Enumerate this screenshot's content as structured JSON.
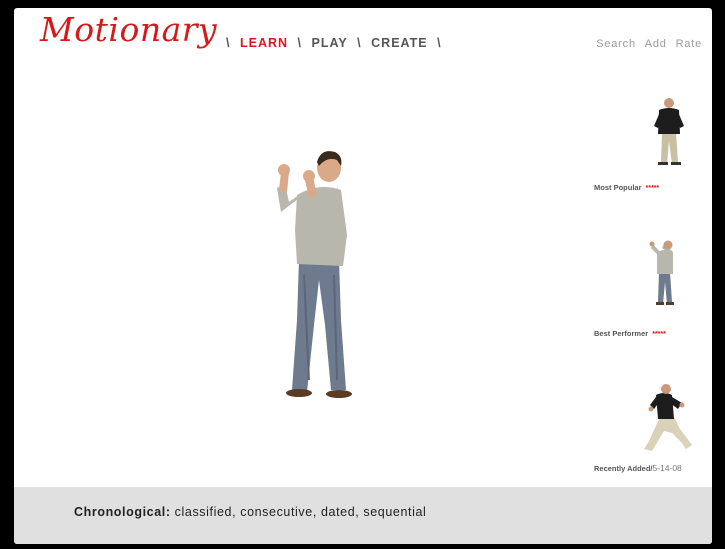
{
  "brand": {
    "logo": "Motionary"
  },
  "nav": {
    "items": [
      {
        "label": "LEARN",
        "active": true
      },
      {
        "label": "PLAY",
        "active": false
      },
      {
        "label": "CREATE",
        "active": false
      }
    ],
    "separator": "\\"
  },
  "toplinks": [
    "Search",
    "Add",
    "Rate"
  ],
  "thumbnails": [
    {
      "caption": "Most Popular",
      "rating": "*****"
    },
    {
      "caption": "Best Performer",
      "rating": "*****"
    },
    {
      "caption": "Recently Added/",
      "date": "5-14-08"
    }
  ],
  "footer": {
    "label": "Chronological:",
    "words": "classified, consecutive, dated, sequential"
  },
  "colors": {
    "accent": "#d41a1a",
    "footer_bg": "#e0e0e0",
    "frame": "#000000"
  }
}
